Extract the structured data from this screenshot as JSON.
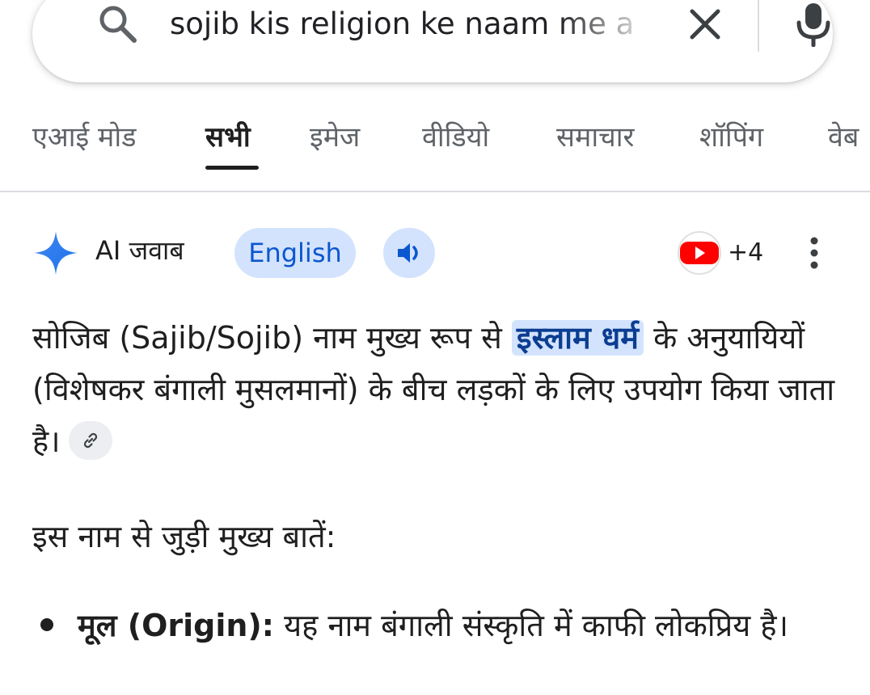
{
  "search": {
    "query": "sojib kis religion ke naam me a"
  },
  "tabs": [
    {
      "label": "एआई मोड"
    },
    {
      "label": "सभी"
    },
    {
      "label": "इमेज"
    },
    {
      "label": "वीडियो"
    },
    {
      "label": "समाचार"
    },
    {
      "label": "शॉपिंग"
    },
    {
      "label": "वेब"
    }
  ],
  "ai_overview": {
    "title": "AI जवाब",
    "language_button": "English",
    "source_count": "+4"
  },
  "answer": {
    "intro_before": "सोजिब (Sajib/Sojib) नाम मुख्य रूप से ",
    "highlight": "इस्लाम धर्म",
    "intro_after": " के अनुयायियों (विशेषकर बंगाली मुसलमानों) के बीच लड़कों के लिए उपयोग किया जाता है।",
    "subheading": "इस नाम से जुड़ी मुख्य बातें:",
    "bullets": [
      {
        "strong": "मूल (Origin):",
        "text": " यह नाम बंगाली संस्कृति में काफी लोकप्रिय है।"
      }
    ]
  },
  "colors": {
    "accent": "#0b57d0",
    "pill_bg": "#d3e3fd",
    "youtube_red": "#ff0000"
  },
  "icons": [
    "search-icon",
    "clear-icon",
    "mic-icon",
    "ai-spark-icon",
    "speaker-icon",
    "youtube-icon",
    "more-vert-icon",
    "link-icon"
  ]
}
